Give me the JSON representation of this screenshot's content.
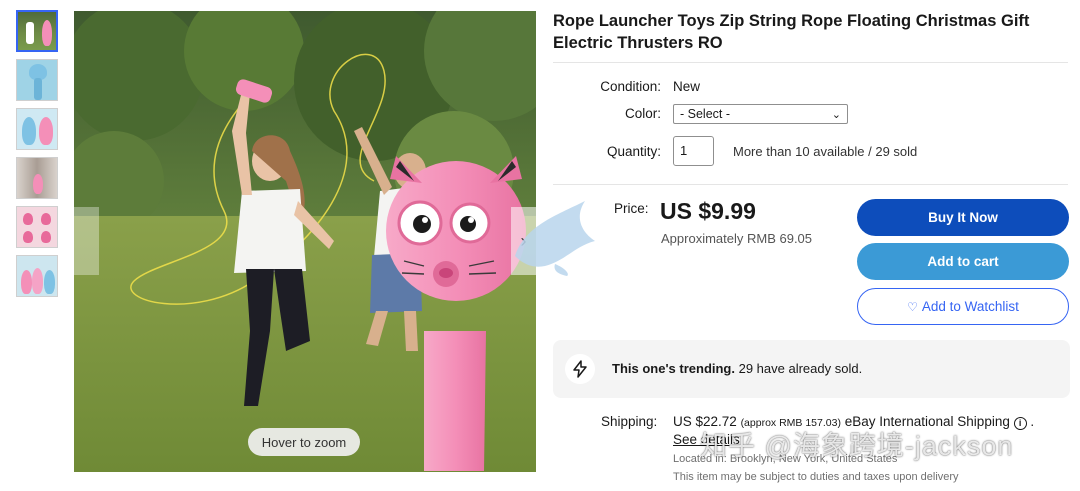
{
  "listing": {
    "title": "Rope Launcher Toys Zip String Rope Floating Christmas Gift Electric Thrusters RO"
  },
  "gallery": {
    "thumbnail_count": 6,
    "active_index": 0,
    "zoom_hint": "Hover to zoom",
    "next_arrow": "›"
  },
  "details": {
    "condition_label": "Condition:",
    "condition_value": "New",
    "color_label": "Color:",
    "color_selected": "- Select -",
    "quantity_label": "Quantity:",
    "quantity_value": "1",
    "availability": "More than 10 available / 29 sold"
  },
  "pricing": {
    "price_label": "Price:",
    "price": "US $9.99",
    "approx": "Approximately RMB 69.05"
  },
  "actions": {
    "buy_now": "Buy It Now",
    "add_to_cart": "Add to cart",
    "watchlist": "Add to Watchlist"
  },
  "trending": {
    "headline": "This one's trending.",
    "detail": " 29 have already sold."
  },
  "shipping": {
    "label": "Shipping:",
    "cost": "US $22.72",
    "approx": "(approx RMB 157.03)",
    "method": "eBay International Shipping",
    "see_details": "See details",
    "location": "Located in: Brooklyn, New York, United States",
    "duties_note": "This item may be subject to duties and taxes upon delivery"
  },
  "watermark": {
    "text": "知乎 @海象跨境-jackson"
  },
  "colors": {
    "buy_button": "#0d4dbb",
    "cart_button": "#3b9ad6",
    "link_blue": "#3665f3",
    "toy_pink": "#f48fb8"
  }
}
